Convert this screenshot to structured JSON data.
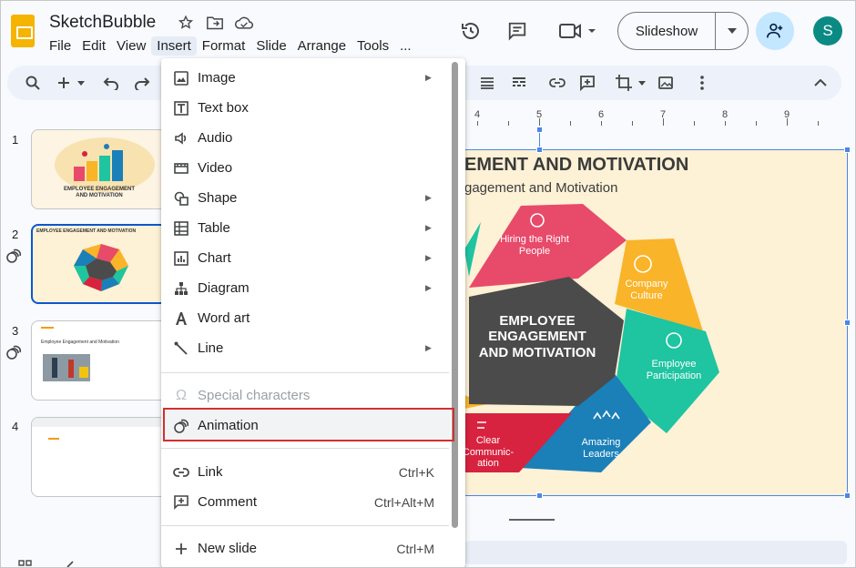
{
  "app": {
    "title": "SketchBubble",
    "menu": [
      "File",
      "Edit",
      "View",
      "Insert",
      "Format",
      "Slide",
      "Arrange",
      "Tools",
      "..."
    ],
    "active_menu": "Insert"
  },
  "header": {
    "slideshow_label": "Slideshow",
    "avatar_initial": "S"
  },
  "ruler": {
    "numbers": [
      "4",
      "5",
      "6",
      "7",
      "8",
      "9"
    ]
  },
  "filmstrip": {
    "slides": [
      {
        "number": "1",
        "caption": "EMPLOYEE ENGAGEMENT AND MOTIVATION"
      },
      {
        "number": "2",
        "caption": "EMPLOYEE ENGAGEMENT AND MOTIVATION"
      },
      {
        "number": "3",
        "caption": "Employee Engagement and Motivation"
      },
      {
        "number": "4",
        "caption": ""
      }
    ]
  },
  "slide": {
    "title": "EMENT AND MOTIVATION",
    "subtitle": "gagement and Motivation",
    "center": "EMPLOYEE ENGAGEMENT AND MOTIVATION",
    "segments": [
      {
        "label": "Hiring the Right People",
        "color": "#e84a6a"
      },
      {
        "label": "Company Culture",
        "color": "#f9b42a"
      },
      {
        "label": "Employee Participation",
        "color": "#1fc4a1"
      },
      {
        "label": "Amazing Leaders",
        "color": "#1b7fb8"
      },
      {
        "label": "Clear Communic- ation",
        "color": "#d7233f"
      }
    ],
    "center_color": "#4b4b4b",
    "background": "#fdf1d6"
  },
  "insert_menu": {
    "items": [
      {
        "label": "Image",
        "icon": "image-icon",
        "submenu": true
      },
      {
        "label": "Text box",
        "icon": "text-box-icon",
        "submenu": false
      },
      {
        "label": "Audio",
        "icon": "audio-icon",
        "submenu": false
      },
      {
        "label": "Video",
        "icon": "video-icon",
        "submenu": false
      },
      {
        "label": "Shape",
        "icon": "shape-icon",
        "submenu": true
      },
      {
        "label": "Table",
        "icon": "table-icon",
        "submenu": true
      },
      {
        "label": "Chart",
        "icon": "chart-icon",
        "submenu": true
      },
      {
        "label": "Diagram",
        "icon": "diagram-icon",
        "submenu": true
      },
      {
        "label": "Word art",
        "icon": "word-art-icon",
        "submenu": false
      },
      {
        "label": "Line",
        "icon": "line-icon",
        "submenu": true
      },
      {
        "label": "Special characters",
        "icon": "omega-icon",
        "disabled": true
      },
      {
        "label": "Animation",
        "icon": "animation-icon",
        "highlighted": true
      },
      {
        "label": "Link",
        "icon": "link-icon",
        "shortcut": "Ctrl+K"
      },
      {
        "label": "Comment",
        "icon": "comment-icon",
        "shortcut": "Ctrl+Alt+M"
      },
      {
        "label": "New slide",
        "icon": "plus-icon",
        "shortcut": "Ctrl+M"
      }
    ]
  }
}
